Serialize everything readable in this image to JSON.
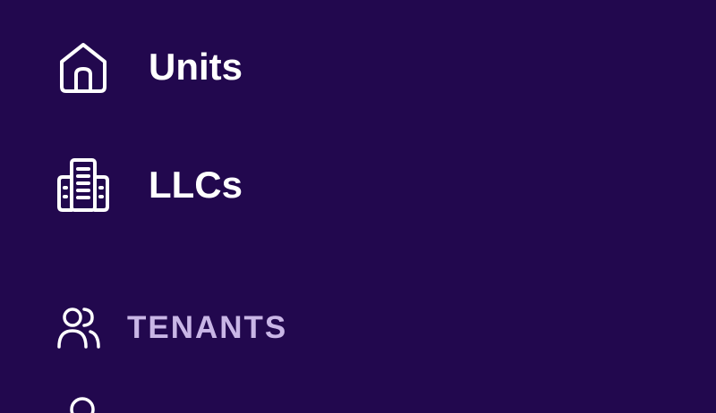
{
  "sidebar": {
    "items": [
      {
        "label": "Units",
        "icon": "home-icon"
      },
      {
        "label": "LLCs",
        "icon": "building-icon"
      }
    ],
    "sections": [
      {
        "label": "TENANTS",
        "icon": "users-icon"
      }
    ]
  },
  "colors": {
    "background": "#22084e",
    "item_text": "#ffffff",
    "section_text": "#c9b6e6"
  }
}
